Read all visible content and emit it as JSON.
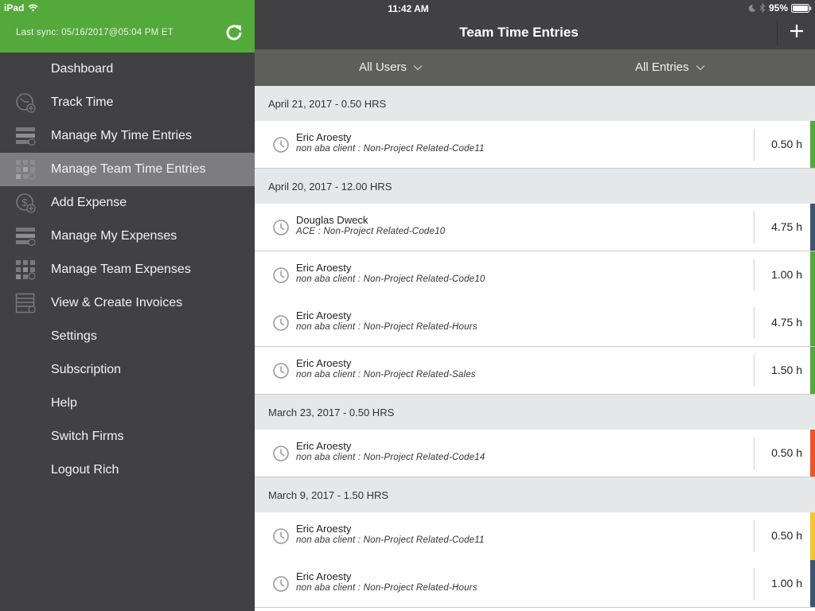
{
  "device": {
    "name": "iPad",
    "time": "11:42 AM",
    "battery": "95%"
  },
  "sidebar": {
    "sync_label": "Last sync:  05/16/2017@05:04 PM ET",
    "items": [
      {
        "label": "Dashboard",
        "icon": "none"
      },
      {
        "label": "Track Time",
        "icon": "clock-plus-icon"
      },
      {
        "label": "Manage My Time Entries",
        "icon": "list-clock-icon"
      },
      {
        "label": "Manage Team Time Entries",
        "icon": "grid-clock-icon",
        "active": true
      },
      {
        "label": "Add Expense",
        "icon": "dollar-plus-icon"
      },
      {
        "label": "Manage My Expenses",
        "icon": "list-dollar-icon"
      },
      {
        "label": "Manage Team Expenses",
        "icon": "grid-dollar-icon"
      },
      {
        "label": "View & Create Invoices",
        "icon": "invoice-icon"
      },
      {
        "label": "Settings",
        "icon": "none"
      },
      {
        "label": "Subscription",
        "icon": "none"
      },
      {
        "label": "Help",
        "icon": "none"
      },
      {
        "label": "Switch Firms",
        "icon": "none"
      },
      {
        "label": "Logout Rich",
        "icon": "none"
      }
    ]
  },
  "header": {
    "title": "Team Time Entries",
    "filters": {
      "users": "All Users",
      "entries": "All Entries"
    }
  },
  "colors": {
    "green": "#53a93a",
    "navy": "#3f5470",
    "orange": "#e9562a",
    "yellow": "#f5c533"
  },
  "groups": [
    {
      "header": "April 21, 2017  -  0.50 HRS",
      "entries": [
        {
          "name": "Eric Aroesty",
          "desc": "non aba client : Non-Project Related-Code11",
          "hours": "0.50 h",
          "color": "#53a93a"
        }
      ]
    },
    {
      "header": "April 20, 2017  -  12.00 HRS",
      "entries": [
        {
          "name": "Douglas Dweck",
          "desc": "ACE : Non-Project Related-Code10",
          "hours": "4.75 h",
          "color": "#3f5470"
        },
        {
          "name": "Eric Aroesty",
          "desc": "non aba client : Non-Project Related-Code10",
          "hours": "1.00 h",
          "color": "#53a93a"
        },
        {
          "name": "Eric Aroesty",
          "desc": "non aba client : Non-Project Related-Hours",
          "hours": "4.75 h",
          "color": "#53a93a"
        },
        {
          "name": "Eric Aroesty",
          "desc": "non aba client : Non-Project Related-Sales",
          "hours": "1.50 h",
          "color": "#53a93a"
        }
      ]
    },
    {
      "header": "March 23, 2017  -  0.50 HRS",
      "entries": [
        {
          "name": "Eric Aroesty",
          "desc": "non aba client : Non-Project Related-Code14",
          "hours": "0.50 h",
          "color": "#e9562a"
        }
      ]
    },
    {
      "header": "March 9, 2017  -  1.50 HRS",
      "entries": [
        {
          "name": "Eric Aroesty",
          "desc": "non aba client : Non-Project Related-Code11",
          "hours": "0.50 h",
          "color": "#f5c533"
        },
        {
          "name": "Eric Aroesty",
          "desc": "non aba client : Non-Project Related-Hours",
          "hours": "1.00 h",
          "color": "#3f5470"
        }
      ]
    }
  ]
}
